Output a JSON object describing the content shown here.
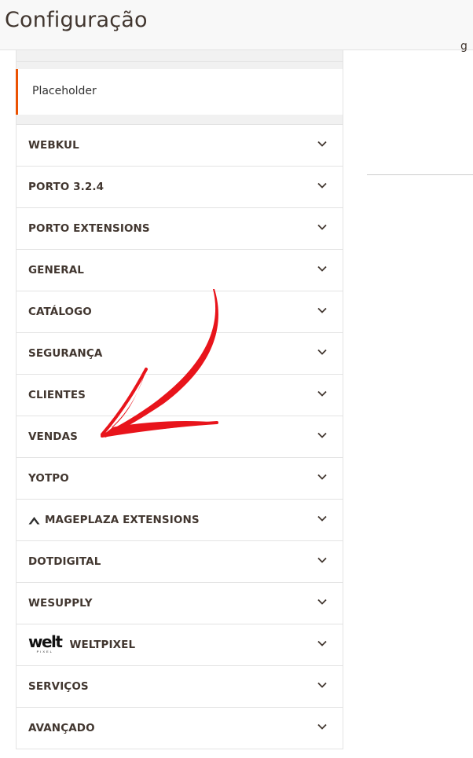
{
  "header": {
    "title": "Configuração",
    "right_glyph": "g"
  },
  "store_scope": {
    "label": "Placeholder"
  },
  "sections": [
    {
      "label": "WEBKUL",
      "icon": "chevron-down-icon"
    },
    {
      "label": "PORTO 3.2.4",
      "icon": "chevron-down-icon"
    },
    {
      "label": "PORTO EXTENSIONS",
      "icon": "chevron-down-icon"
    },
    {
      "label": "GENERAL",
      "icon": "chevron-down-icon"
    },
    {
      "label": "CATÁLOGO",
      "icon": "chevron-down-icon"
    },
    {
      "label": "SEGURANÇA",
      "icon": "chevron-down-icon"
    },
    {
      "label": "CLIENTES",
      "icon": "chevron-down-icon"
    },
    {
      "label": "VENDAS",
      "icon": "chevron-down-icon"
    },
    {
      "label": "YOTPO",
      "icon": "chevron-down-icon"
    },
    {
      "label": "MAGEPLAZA EXTENSIONS",
      "icon": "chevron-down-icon",
      "vendor_icon": "mageplaza-logo-icon"
    },
    {
      "label": "DOTDIGITAL",
      "icon": "chevron-down-icon"
    },
    {
      "label": "WESUPPLY",
      "icon": "chevron-down-icon"
    },
    {
      "label": "WELTPIXEL",
      "icon": "chevron-down-icon",
      "vendor_logo": {
        "word": "welt",
        "sub": "PIXEL"
      }
    },
    {
      "label": "SERVIÇOS",
      "icon": "chevron-down-icon"
    },
    {
      "label": "AVANÇADO",
      "icon": "chevron-down-icon"
    }
  ],
  "colors": {
    "accent": "#eb5202",
    "annotation_arrow": "#e8141b",
    "text": "#41362f",
    "border": "#e3e3e3",
    "header_bg": "#f8f8f8"
  }
}
